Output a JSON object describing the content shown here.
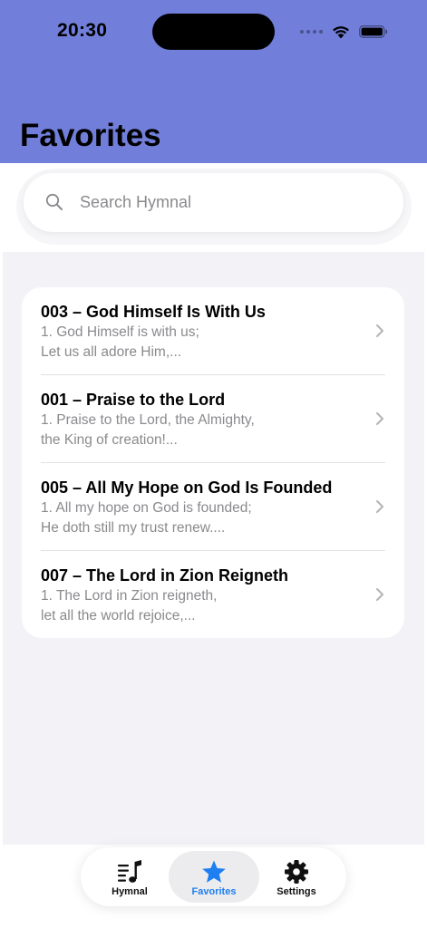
{
  "status_bar": {
    "time": "20:30"
  },
  "header": {
    "title": "Favorites",
    "background_color": "#717fdb"
  },
  "search": {
    "placeholder": "Search Hymnal",
    "value": ""
  },
  "favorites": [
    {
      "title": "003 – God Himself Is With Us",
      "line1": "1. God Himself is with us;",
      "line2": "Let us all adore Him,..."
    },
    {
      "title": "001 – Praise to the Lord",
      "line1": "1. Praise to the Lord, the Almighty,",
      "line2": "the King of creation!..."
    },
    {
      "title": "005 – All My Hope on God Is Founded",
      "line1": "1. All my hope on God is founded;",
      "line2": "He doth still my trust renew...."
    },
    {
      "title": "007 – The Lord in Zion Reigneth",
      "line1": "1. The Lord in Zion reigneth,",
      "line2": "let all the world rejoice,..."
    }
  ],
  "tabs": [
    {
      "label": "Hymnal",
      "icon": "music-list-icon",
      "active": false
    },
    {
      "label": "Favorites",
      "icon": "star-icon",
      "active": true
    },
    {
      "label": "Settings",
      "icon": "gear-icon",
      "active": false
    }
  ],
  "colors": {
    "accent": "#1d7ff0",
    "list_background": "#f2f2f7"
  }
}
